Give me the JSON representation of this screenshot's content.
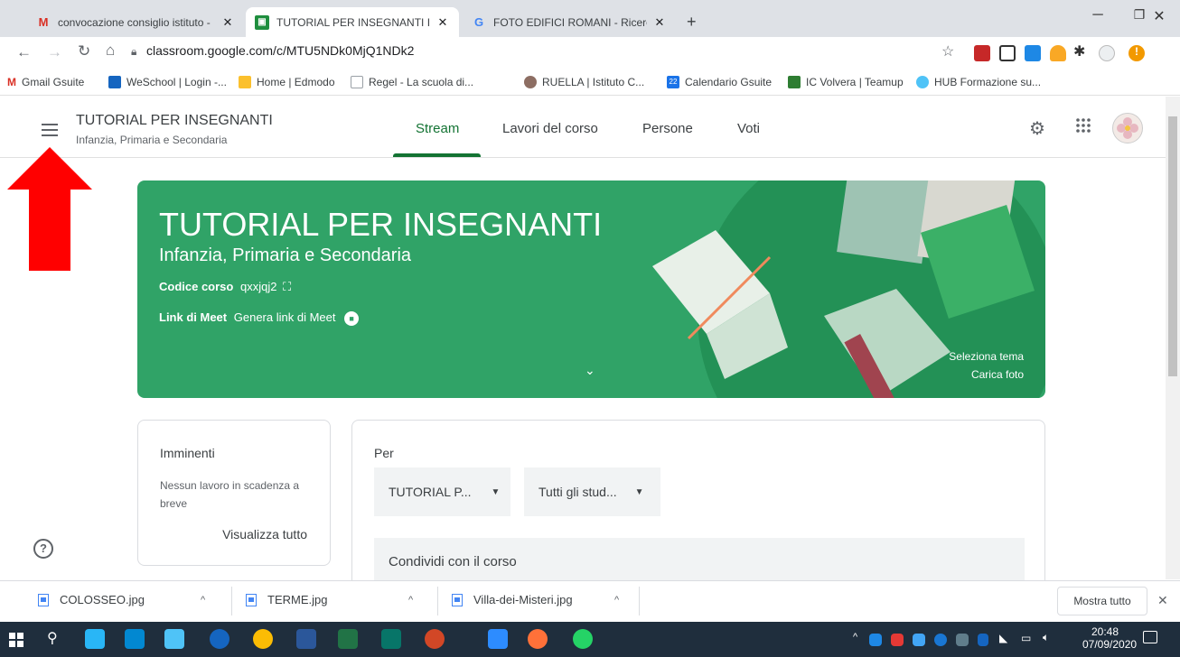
{
  "browser": {
    "tabs": [
      {
        "title": "convocazione consiglio istituto -",
        "favicon": "gmail-icon"
      },
      {
        "title": "TUTORIAL PER INSEGNANTI Infar",
        "favicon": "classroom-icon"
      },
      {
        "title": "FOTO EDIFICI ROMANI - Ricerca",
        "favicon": "google-icon"
      }
    ],
    "new_tab": "+",
    "url": "classroom.google.com/c/MTU5NDk0MjQ1NDk2",
    "bookmarks": [
      "Gmail Gsuite",
      "WeSchool | Login -...",
      "Home | Edmodo",
      "Regel - La scuola di...",
      "RUELLA | Istituto C...",
      "Calendario Gsuite",
      "IC Volvera | Teamup",
      "HUB Formazione su..."
    ],
    "calendar_badge": "22"
  },
  "classroom": {
    "class_name": "TUTORIAL PER INSEGNANTI",
    "section": "Infanzia, Primaria e Secondaria",
    "tabs": [
      "Stream",
      "Lavori del corso",
      "Persone",
      "Voti"
    ],
    "banner": {
      "title": "TUTORIAL PER INSEGNANTI",
      "subtitle": "Infanzia, Primaria e Secondaria",
      "code_label": "Codice corso",
      "code_value": "qxxjqj2",
      "meet_label": "Link di Meet",
      "meet_value": "Genera link di Meet",
      "select_theme": "Seleziona tema",
      "upload_photo": "Carica foto"
    },
    "upcoming": {
      "title": "Imminenti",
      "empty": "Nessun lavoro in scadenza a breve",
      "view_all": "Visualizza tutto"
    },
    "share": {
      "for_label": "Per",
      "class_select": "TUTORIAL P...",
      "students_select": "Tutti gli stud...",
      "placeholder": "Condividi con il corso"
    }
  },
  "downloads": {
    "files": [
      "COLOSSEO.jpg",
      "TERME.jpg",
      "Villa-dei-Misteri.jpg"
    ],
    "show_all": "Mostra tutto"
  },
  "taskbar": {
    "time": "20:48",
    "date": "07/09/2020"
  },
  "colors": {
    "banner_green": "#30a367",
    "accent_green": "#137333",
    "annotation_arrow": "#ff0000"
  }
}
